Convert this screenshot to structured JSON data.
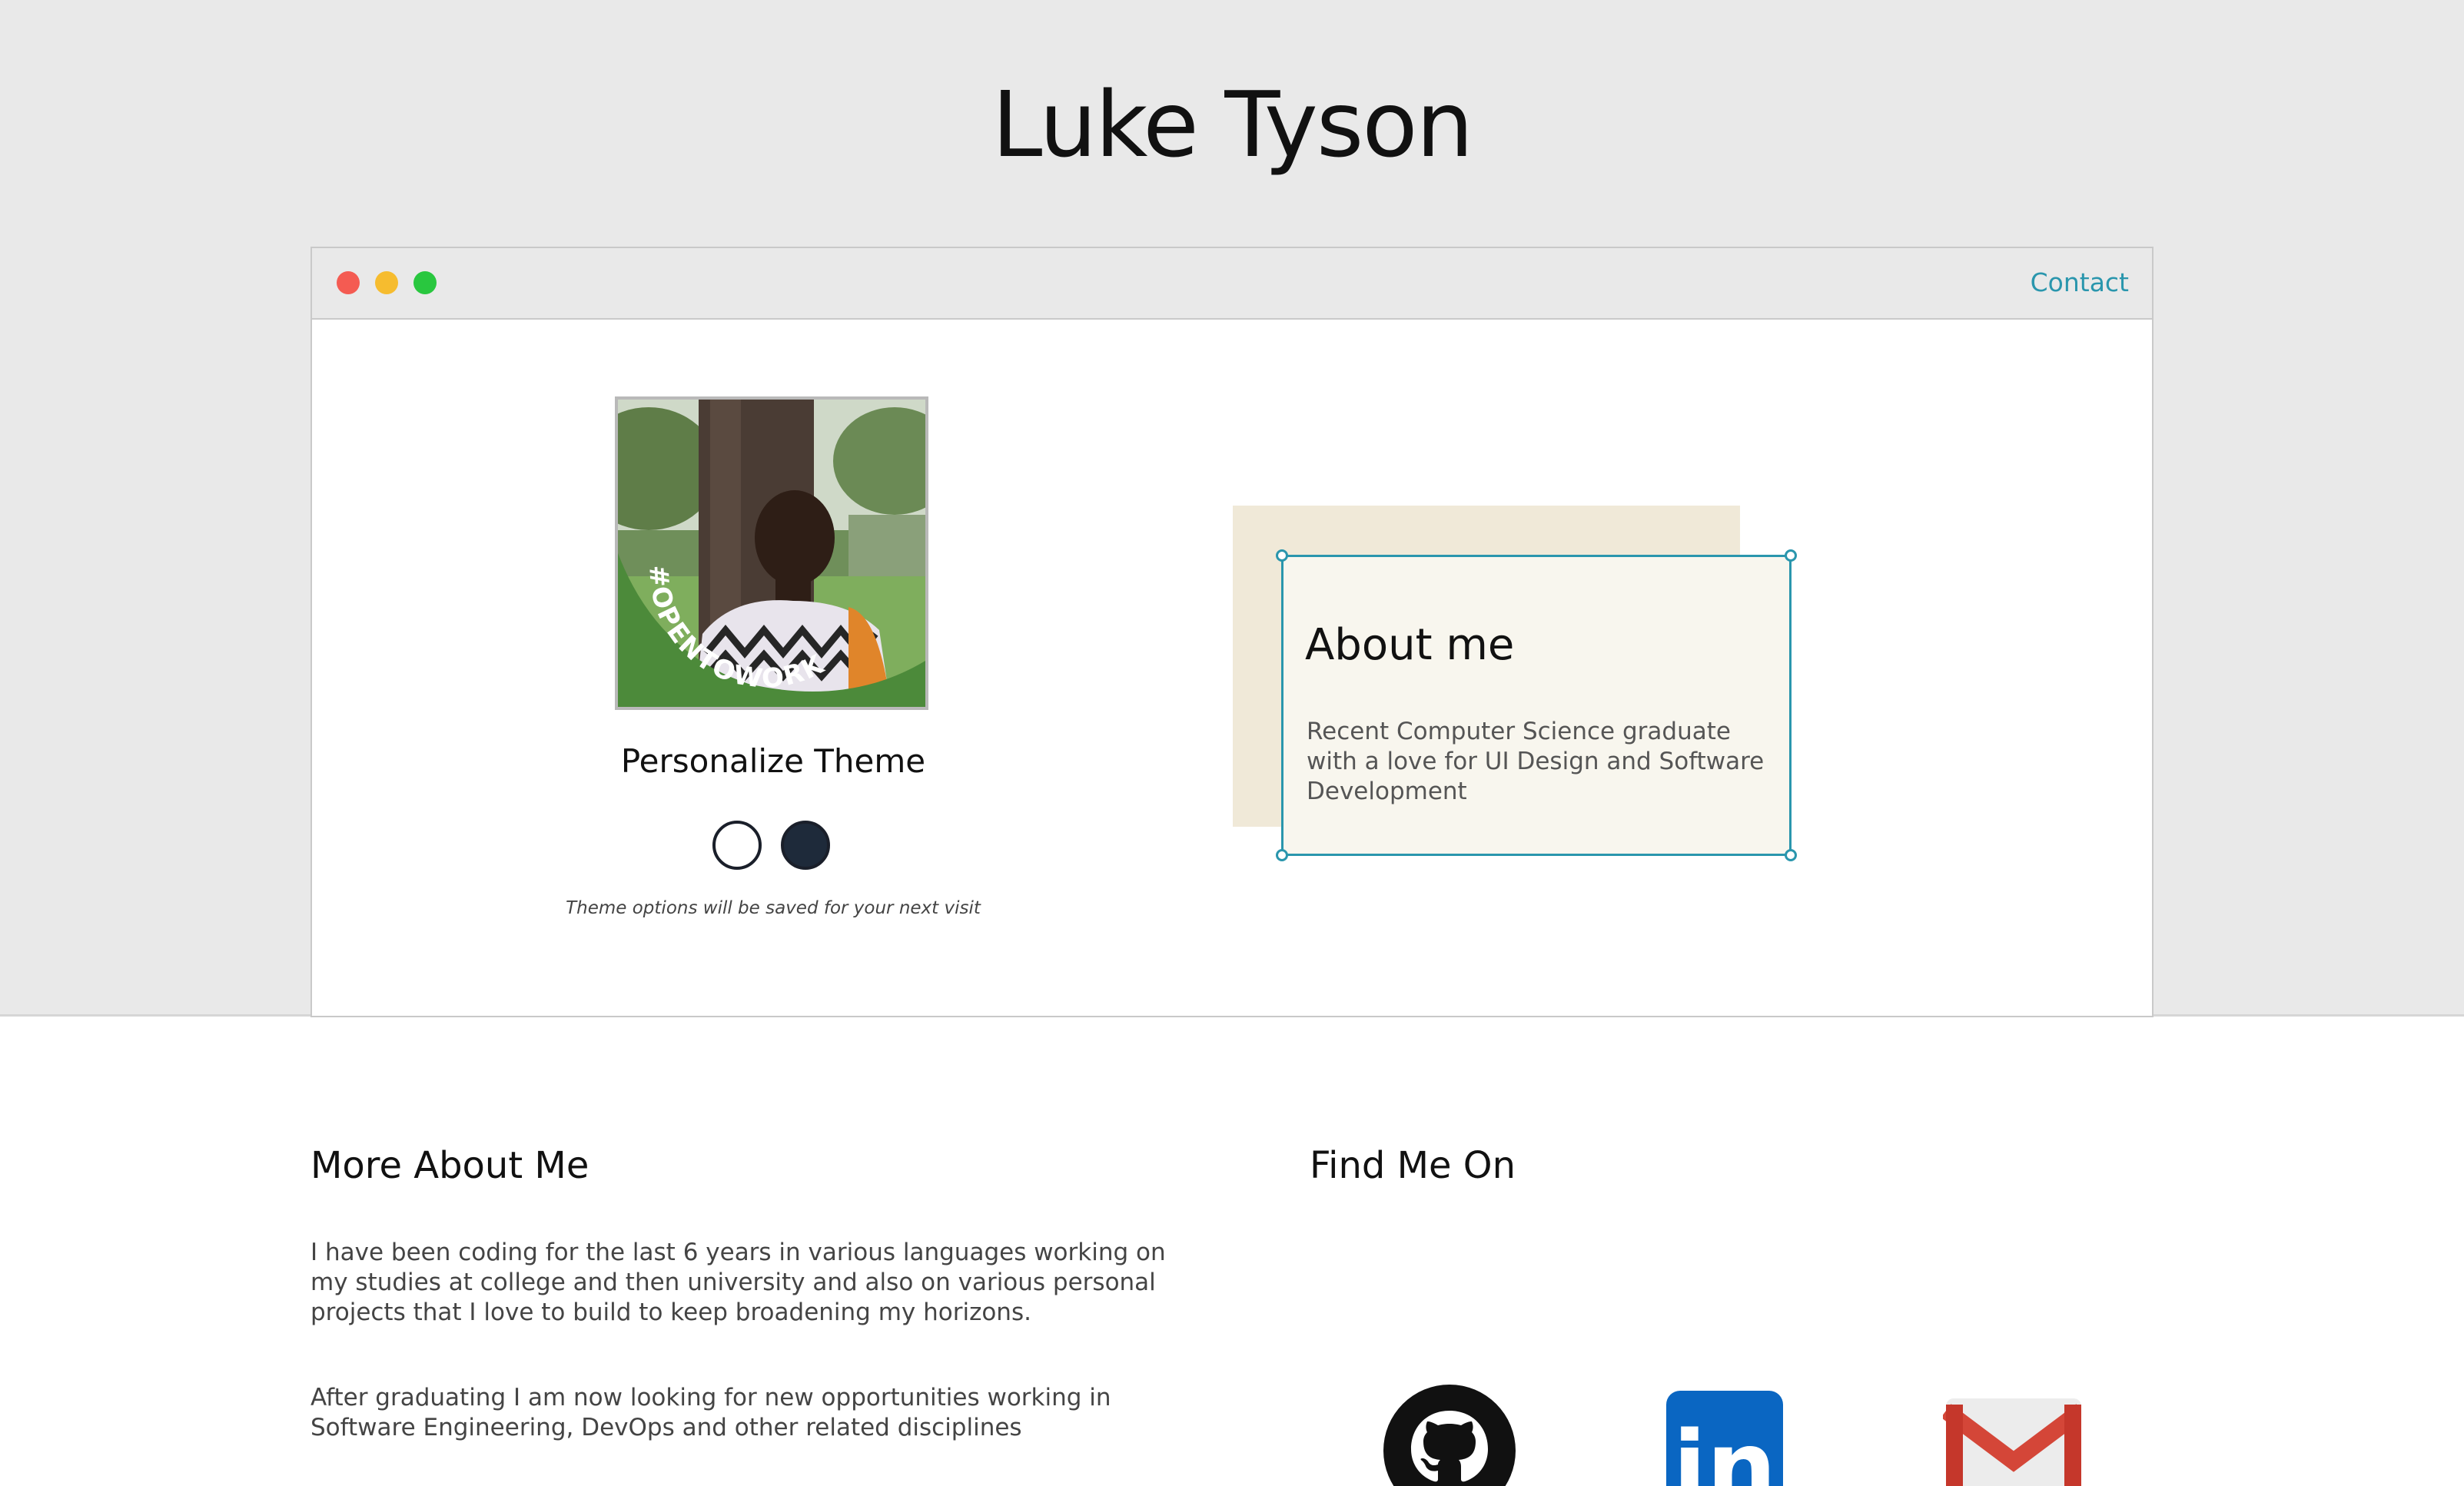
{
  "site": {
    "title": "Luke Tyson"
  },
  "window": {
    "contact_label": "Contact"
  },
  "profile": {
    "badge_text": "#OPENTOWORK",
    "theme_title": "Personalize Theme",
    "theme_options": [
      "light",
      "dark"
    ],
    "theme_note": "Theme options will be saved for your next visit"
  },
  "about": {
    "heading": "About me",
    "text": "Recent Computer Science graduate with a love for UI Design and Software Development"
  },
  "more": {
    "heading": "More About Me",
    "paragraphs": [
      "I have been coding for the last 6 years in various languages working on my studies at college and then university and also on various personal projects that I love to build to keep broadening my horizons.",
      "After graduating I am now looking for new opportunities working in Software Engineering, DevOps and other related disciplines"
    ]
  },
  "find": {
    "heading": "Find Me On",
    "links": [
      {
        "icon": "github-icon"
      },
      {
        "icon": "linkedin-icon",
        "logo_text": "in"
      },
      {
        "icon": "gmail-icon"
      }
    ]
  },
  "colors": {
    "accent": "#2a96ad",
    "page_band": "#e9e9e9",
    "badge_green": "#4c8a3a",
    "linkedin_blue": "#0a66c2",
    "gmail_red": "#d44638"
  }
}
